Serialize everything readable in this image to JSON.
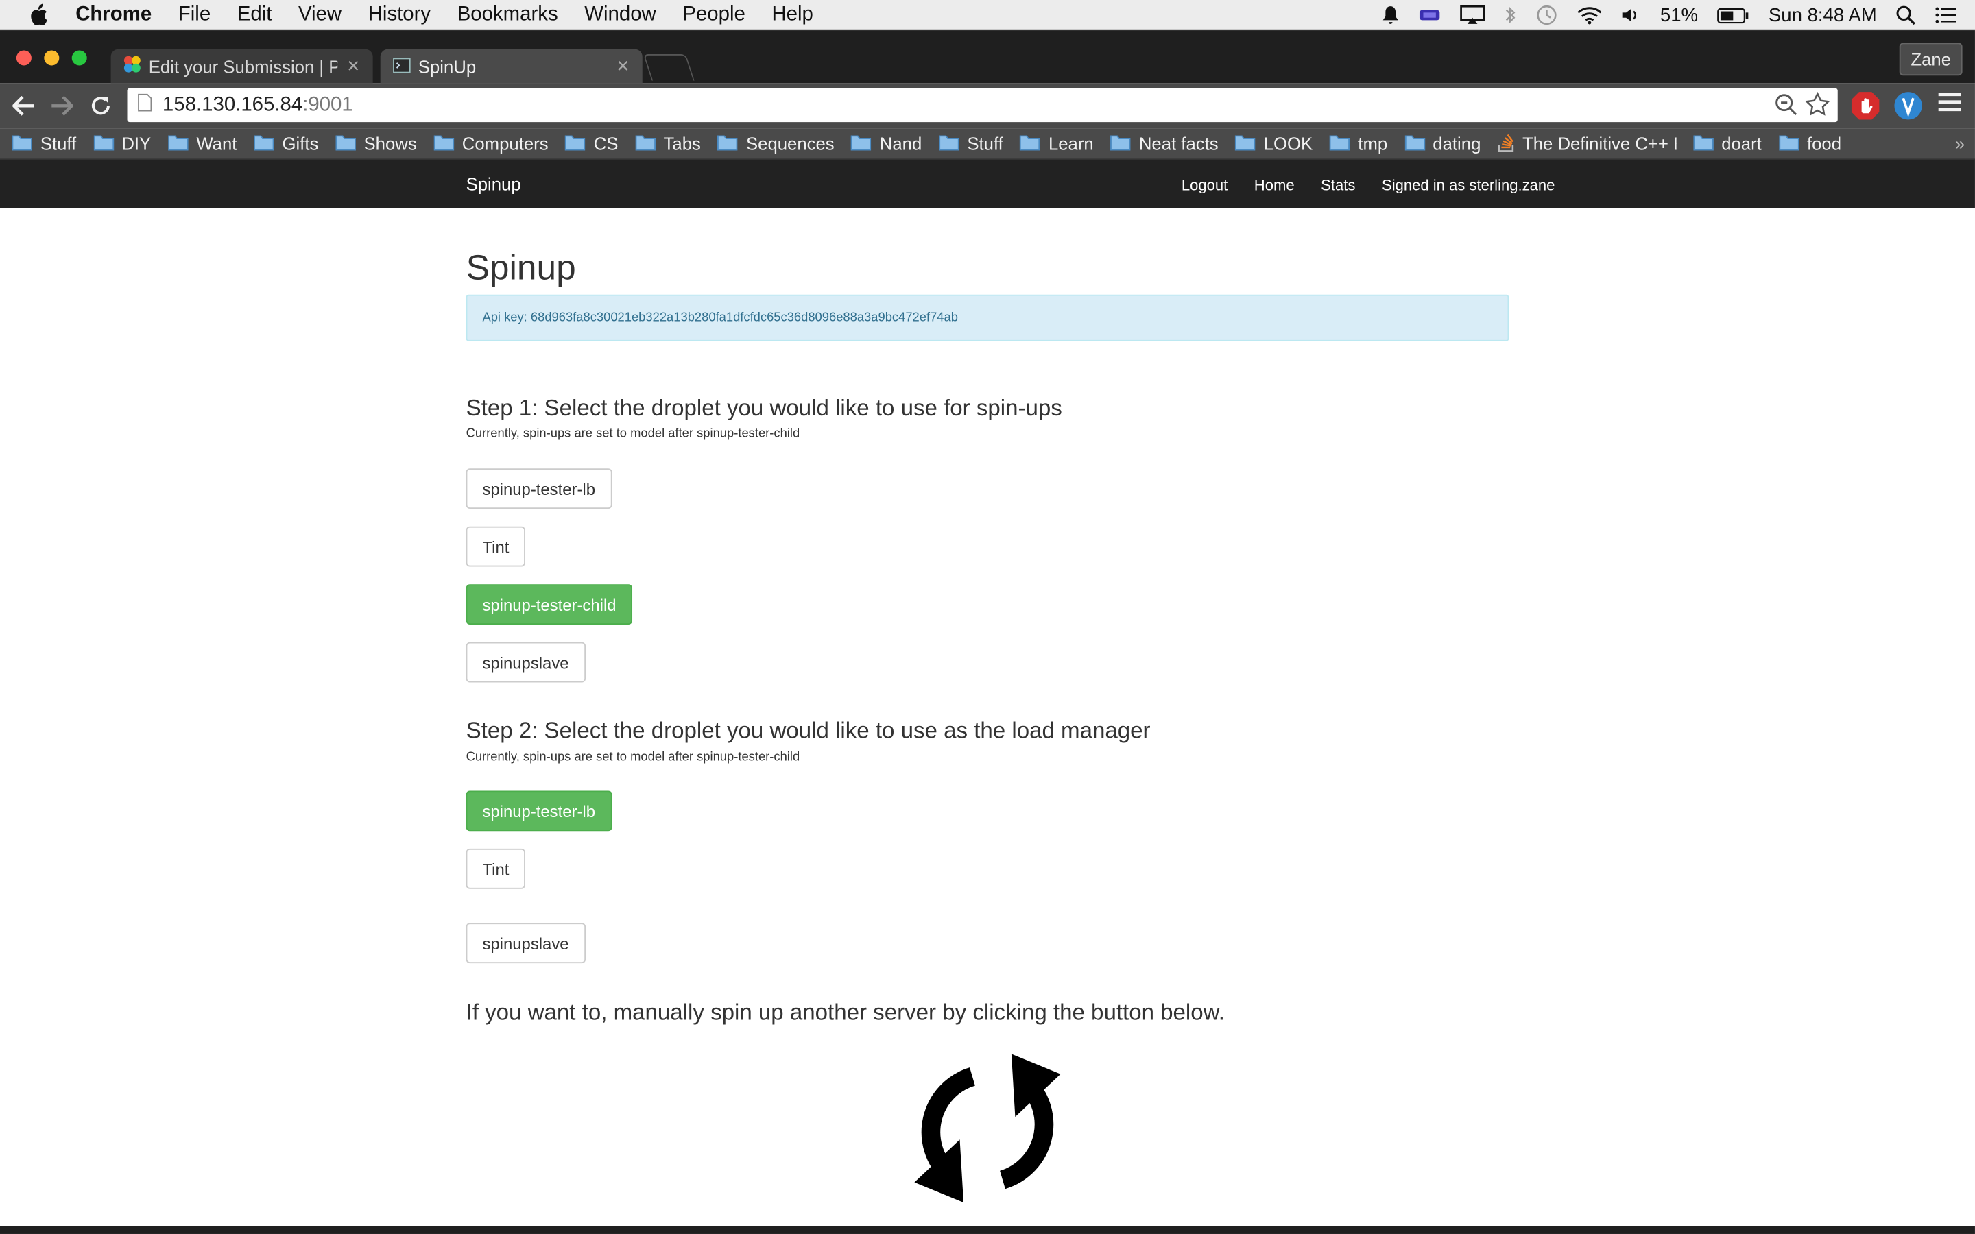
{
  "menubar": {
    "app_name": "Chrome",
    "menus": [
      "File",
      "Edit",
      "View",
      "History",
      "Bookmarks",
      "Window",
      "People",
      "Help"
    ],
    "battery": "51%",
    "clock": "Sun 8:48 AM"
  },
  "tabs": [
    {
      "label": "Edit your Submission | Pen"
    },
    {
      "label": "SpinUp"
    }
  ],
  "profile_name": "Zane",
  "address": {
    "host": "158.130.165.84",
    "port": ":9001"
  },
  "bookmarks": [
    "Stuff",
    "DIY",
    "Want",
    "Gifts",
    "Shows",
    "Computers",
    "CS",
    "Tabs",
    "Sequences",
    "Nand",
    "Stuff",
    "Learn",
    "Neat facts",
    "LOOK",
    "tmp",
    "dating",
    "The Definitive C++ B",
    "doart",
    "food"
  ],
  "bookmarks_more": "»",
  "site": {
    "brand": "Spinup",
    "nav": {
      "logout": "Logout",
      "home": "Home",
      "stats": "Stats",
      "signed_in": "Signed in as sterling.zane"
    }
  },
  "page": {
    "title": "Spinup",
    "api_key_text": "Api key: 68d963fa8c30021eb322a13b280fa1dfcfdc65c36d8096e88a3a9bc472ef74ab",
    "step1": {
      "heading": "Step 1: Select the droplet you would like to use for spin-ups",
      "subtext": "Currently, spin-ups are set to model after spinup-tester-child",
      "droplets": [
        "spinup-tester-lb",
        "Tint",
        "spinup-tester-child",
        "spinupslave"
      ],
      "selected": "spinup-tester-child"
    },
    "step2": {
      "heading": "Step 2: Select the droplet you would like to use as the load manager",
      "subtext": "Currently, spin-ups are set to model after spinup-tester-child",
      "droplets": [
        "spinup-tester-lb",
        "Tint",
        "spinupslave"
      ],
      "selected": "spinup-tester-lb"
    },
    "manual_heading": "If you want to, manually spin up another server by clicking the button below."
  },
  "colors": {
    "success": "#5cb85c",
    "alert_bg": "#d9edf7",
    "alert_text": "#31708f",
    "navbar": "#222222"
  },
  "icons": [
    "apple-icon",
    "bell-icon",
    "wifi-icon",
    "search-icon",
    "list-icon",
    "back-arrow-icon",
    "forward-arrow-icon",
    "reload-icon",
    "star-icon",
    "zoom-icon",
    "menu-icon",
    "folder-icon",
    "refresh-icon"
  ]
}
